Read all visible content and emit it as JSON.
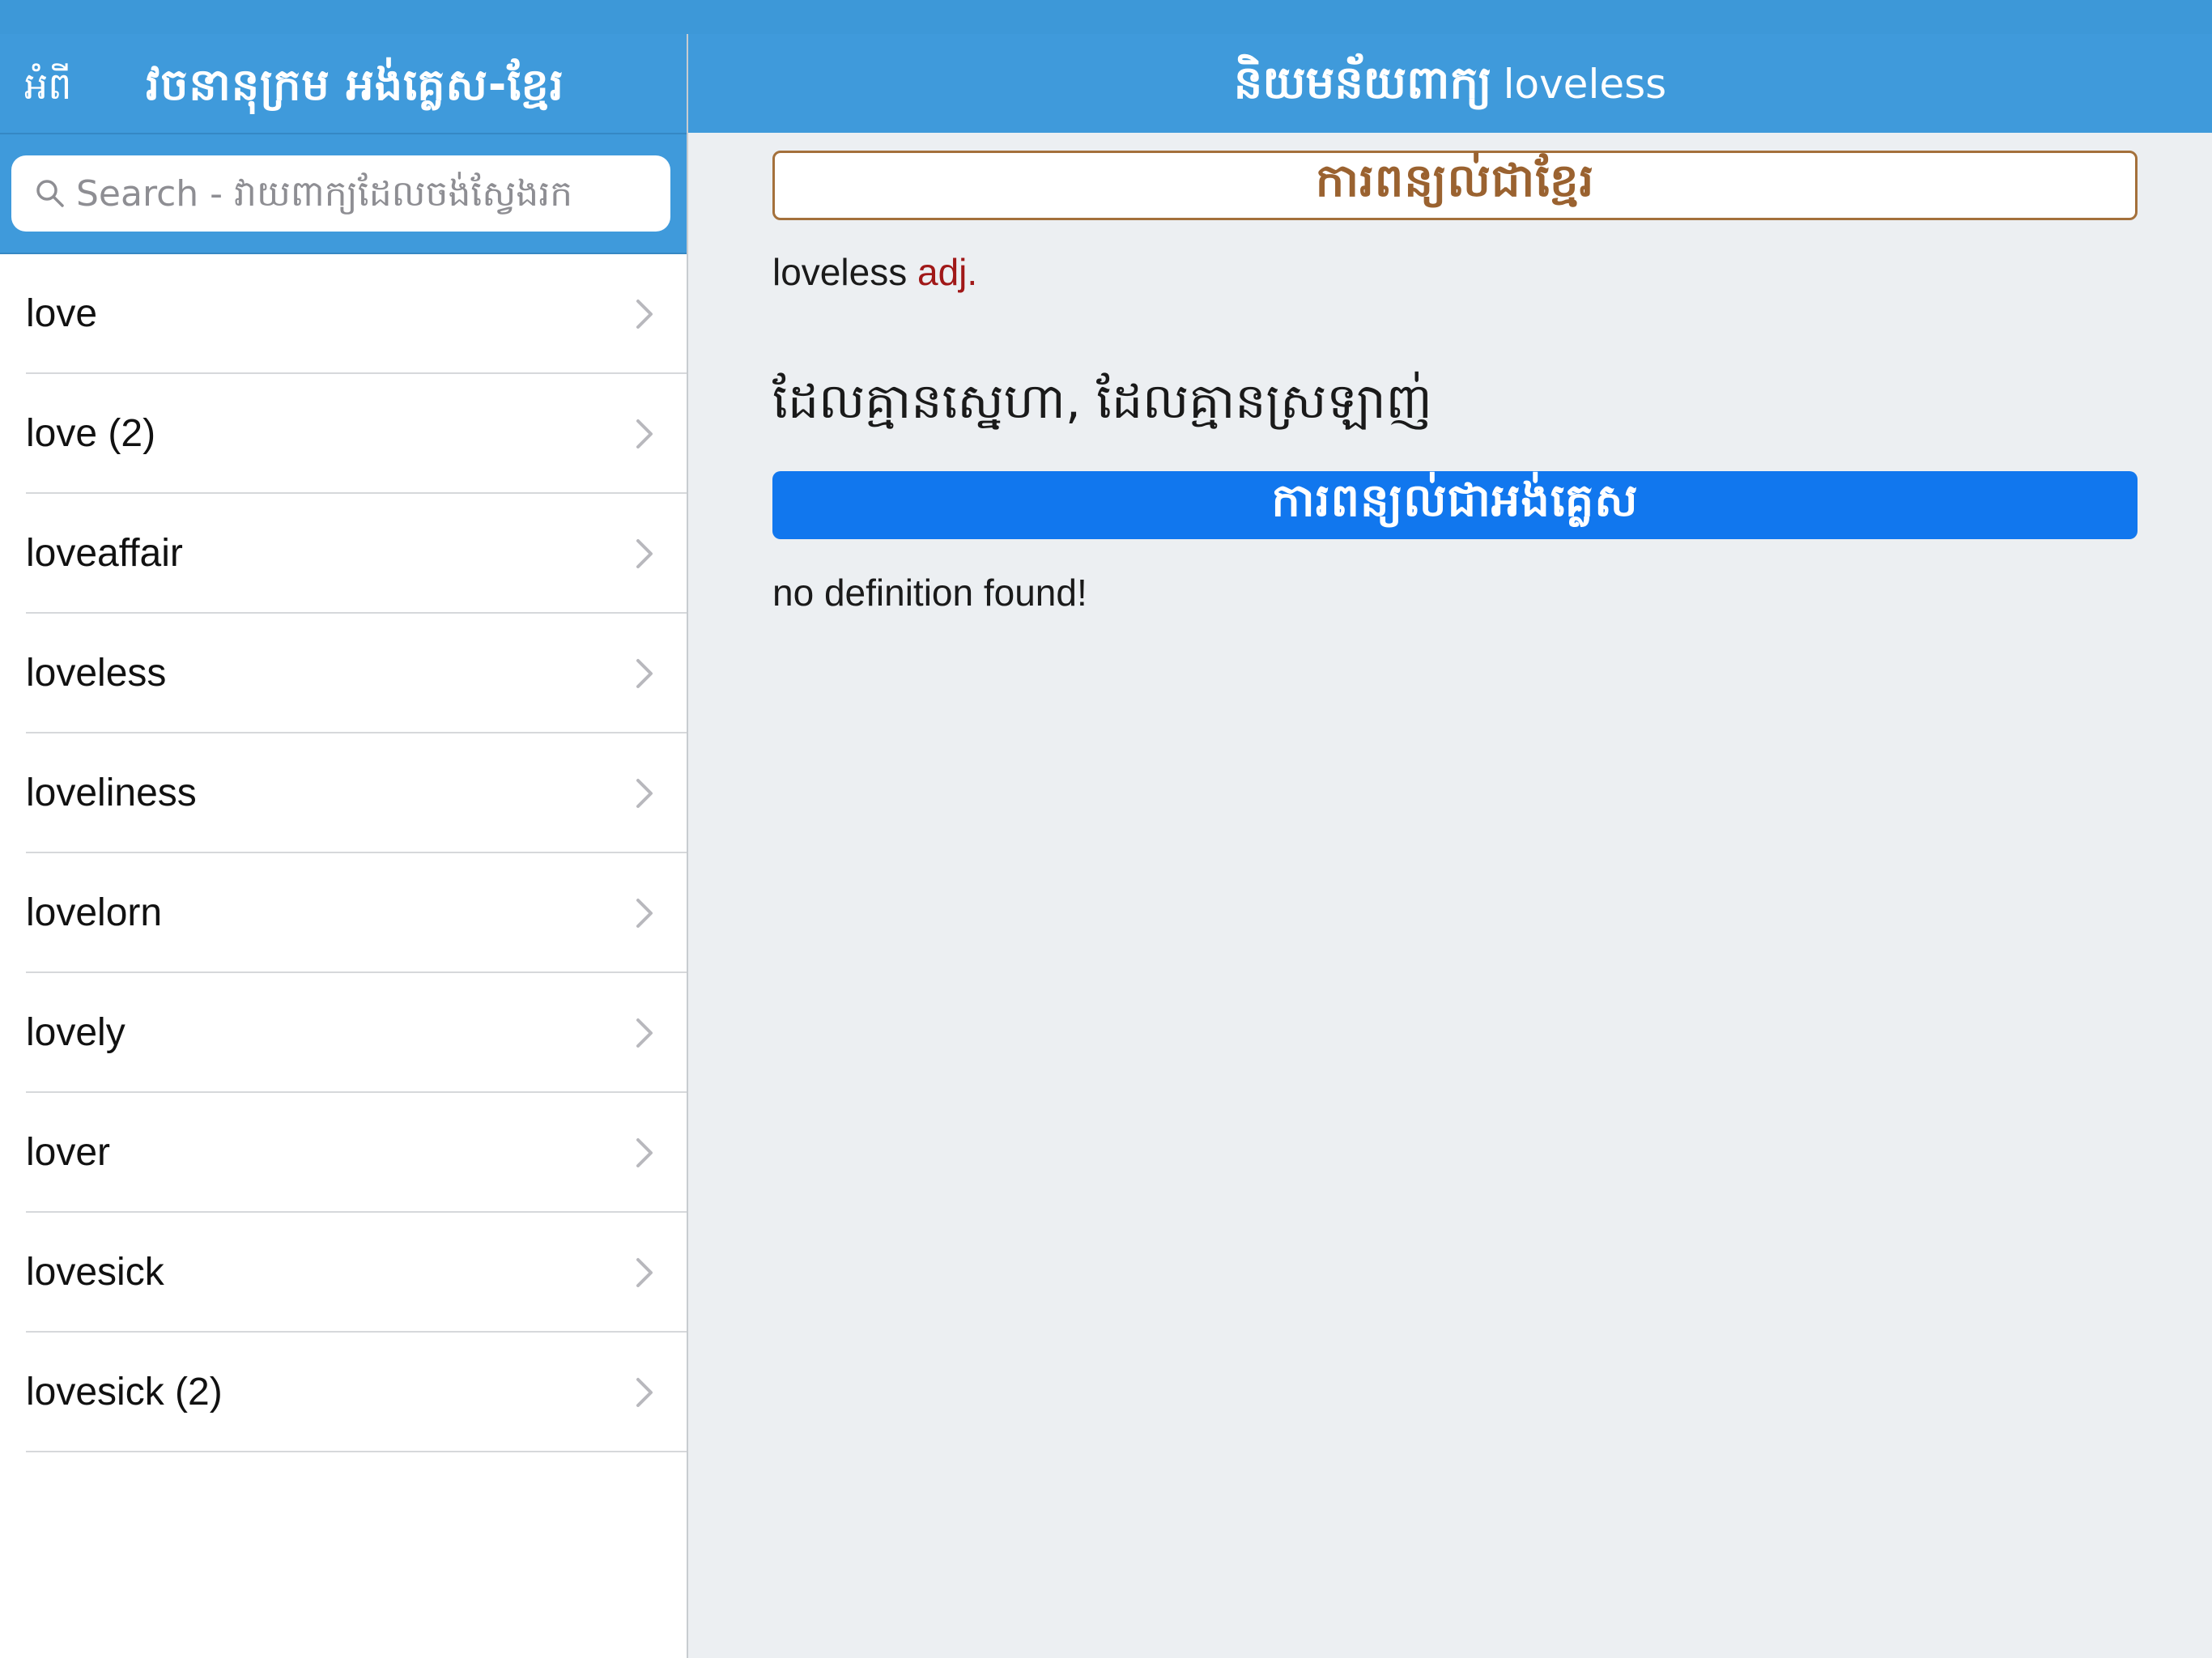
{
  "sidebar": {
    "about_label": "អំពី",
    "title": "វចនានុក្រម អង់គ្លេស-ខ្មែរ",
    "search": {
      "value": "",
      "placeholder": "Search - វាយពាក្យដែលចង់ស្វែងរក"
    },
    "items": [
      {
        "label": "love"
      },
      {
        "label": "love (2)"
      },
      {
        "label": "loveaffair"
      },
      {
        "label": "loveless"
      },
      {
        "label": "loveliness"
      },
      {
        "label": "lovelorn"
      },
      {
        "label": "lovely"
      },
      {
        "label": "lover"
      },
      {
        "label": "lovesick"
      },
      {
        "label": "lovesick (2)"
      }
    ]
  },
  "detail": {
    "title_khmer": "និយមន័យពាក្យ",
    "title_word": "loveless",
    "khmer_section_label": "ការពន្យល់ជាខ្មែរ",
    "entry_word": "loveless",
    "entry_pos": "adj.",
    "khmer_definition": "ដែលគ្មានស្នេហា, ដែលគ្មានស្រឡាញ់",
    "english_section_label": "ការពន្យល់ជាអង់គ្លេស",
    "english_definition": "no definition found!"
  },
  "colors": {
    "nav_bar": "#3f9adb",
    "khmer_section_border": "#a4703b",
    "english_section_bg": "#1177ee",
    "pos_text": "#a01818"
  }
}
